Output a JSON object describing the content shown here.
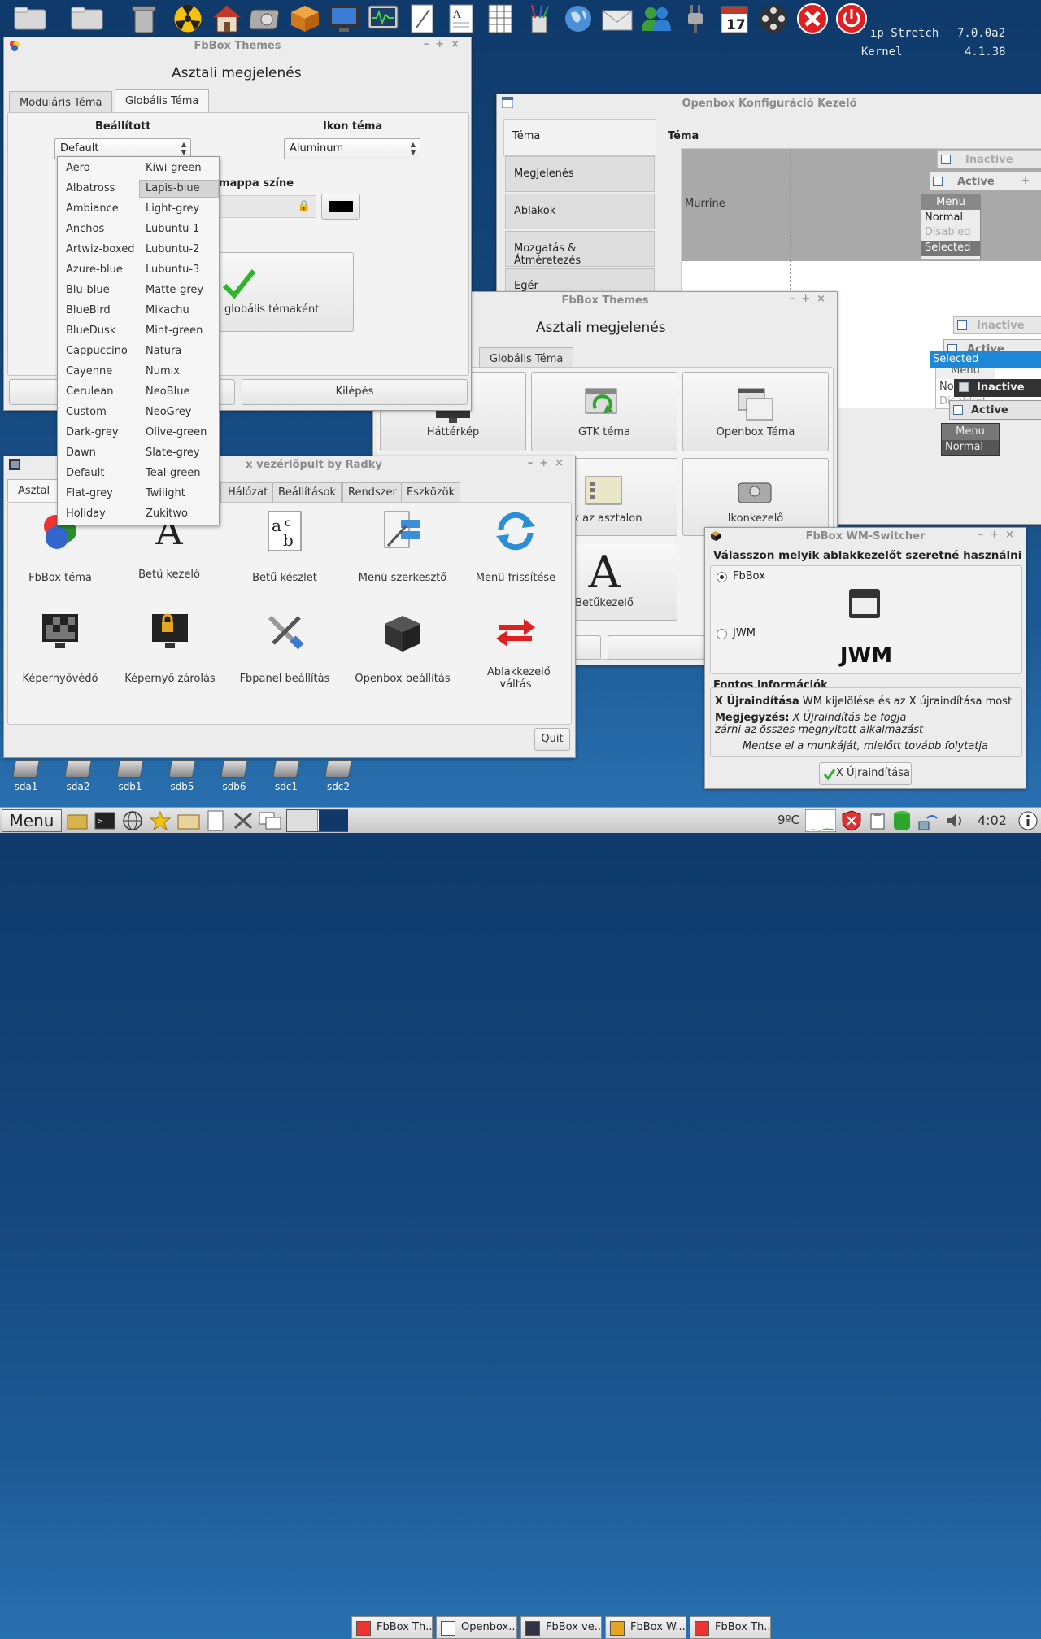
{
  "desktop": {
    "conky_line1_label": "ıp Stretch",
    "conky_line1_value": "7.0.0a2",
    "conky_line2_label": "Kernel",
    "conky_line2_value": "4.1.38"
  },
  "top_icons": [
    "folder-icon",
    "folder-icon",
    "trash-icon",
    "radiation-icon",
    "home-icon",
    "harddisk-icon",
    "package-icon",
    "monitor-icon",
    "system-monitor-icon",
    "text-editor-icon",
    "document-icon",
    "spreadsheet-icon",
    "paint-icon",
    "globe-icon",
    "mail-icon",
    "users-icon",
    "plug-icon",
    "calendar-icon",
    "film-reel-icon",
    "close-red-icon",
    "power-icon"
  ],
  "calendar_day": "17",
  "themes_win1": {
    "title": "FbBox Themes",
    "heading": "Asztali megjelenés",
    "tab1": "Moduláris Téma",
    "tab2": "Globális Téma",
    "label_set": "Beállított",
    "label_icon": "Ikon téma",
    "combo_value": "Default",
    "icon_combo": "Aluminum",
    "folder_color_label": "mappa színe",
    "apply_label": "globális témaként",
    "exit": "Kilépés"
  },
  "dropdown": {
    "col1": [
      "Aero",
      "Albatross",
      "Ambiance",
      "Anchos",
      "Artwiz-boxed",
      "Azure-blue",
      "Blu-blue",
      "BlueBird",
      "BlueDusk",
      "Cappuccino",
      "Cayenne",
      "Cerulean",
      "Custom",
      "Dark-grey",
      "Dawn",
      "Default",
      "Flat-grey",
      "Holiday"
    ],
    "col2": [
      "Kiwi-green",
      "Lapis-blue",
      "Light-grey",
      "Lubuntu-1",
      "Lubuntu-2",
      "Lubuntu-3",
      "Matte-grey",
      "Mikachu",
      "Mint-green",
      "Natura",
      "Numix",
      "NeoBlue",
      "NeoGrey",
      "Olive-green",
      "Slate-grey",
      "Teal-green",
      "Twilight",
      "Zukitwo"
    ],
    "highlight": "Lapis-blue"
  },
  "openbox": {
    "title": "Openbox Konfiguráció Kezelő",
    "sidebar": [
      "Téma",
      "Megjelenés",
      "Ablakok",
      "Mozgatás & Átméretezés",
      "Egér"
    ],
    "heading": "Téma",
    "theme_name": "Murrine",
    "prev": {
      "inactive": "Inactive",
      "active": "Active",
      "menu": "Menu",
      "normal": "Normal",
      "disabled": "Disabled",
      "selected": "Selected"
    }
  },
  "themes_win2": {
    "title": "FbBox Themes",
    "heading": "Asztali megjelenés",
    "tab": "Globális Téma",
    "items": [
      "Háttérkép",
      "GTK téma",
      "Openbox Téma",
      "ok az asztalon",
      "Ikonkezelő",
      "Betűkezelő"
    ]
  },
  "control": {
    "title": "x vezérlőpult by Radky",
    "tabs": [
      "Asztal",
      "Hálózat",
      "Beállítások",
      "Rendszer",
      "Eszközök"
    ],
    "items_row1": [
      "FbBox téma",
      "Betű kezelő",
      "Betű készlet",
      "Menü szerkesztő",
      "Menü frissítése"
    ],
    "items_row2": [
      "Képernyővédő",
      "Képernyő zárolás",
      "Fbpanel beállítás",
      "Openbox beállítás",
      "Ablakkezelő váltás"
    ],
    "quit": "Quit"
  },
  "wmswitch": {
    "title": "FbBox WM-Switcher",
    "question": "Válasszon melyik ablakkezelőt  szeretné használni",
    "opt1": "FbBox",
    "opt2": "JWM",
    "big": "JWM",
    "info_title": "Fontos információk",
    "l1_bold": "X Újraindítása",
    "l1_rest": "WM kijelölése és az X újraindítása most",
    "l2_bold": "Megjegyzés:",
    "l2_rest": "X Újraindítás be fogja",
    "l3": "zárni az összes megnyitott alkalmazást",
    "l4": "Mentse el a munkáját, mielőtt tovább  folytatja",
    "button": "X Újraindítása"
  },
  "drives": [
    "sda1",
    "sda2",
    "sdb1",
    "sdb5",
    "sdb6",
    "sdc1",
    "sdc2"
  ],
  "taskbar": {
    "menu": "Menu",
    "tasks": [
      "FbBox Th...",
      "Openbox...",
      "FbBox ve...",
      "FbBox W...",
      "FbBox Th..."
    ],
    "temp": "9ºC",
    "clock": "4:02"
  },
  "colors": {
    "selection": "#1e88d8",
    "ok_green": "#2db52d",
    "restart_red": "#e02020"
  }
}
